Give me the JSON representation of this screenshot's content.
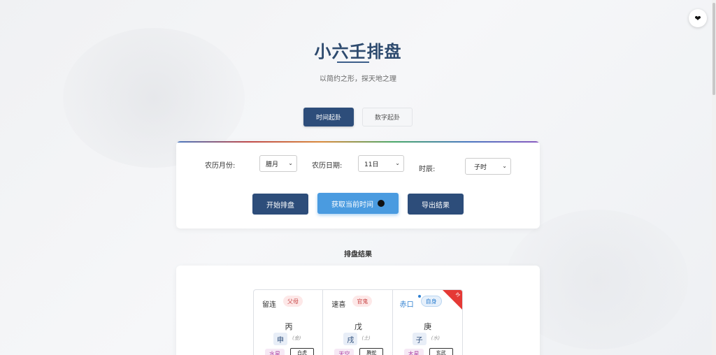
{
  "header": {
    "title": "小六壬排盘",
    "subtitle": "以简约之形，探天地之理",
    "favorite_icon": "heart-icon"
  },
  "tabs": [
    {
      "label": "时间起卦",
      "active": true
    },
    {
      "label": "数字起卦",
      "active": false
    }
  ],
  "form": {
    "month_label": "农历月份:",
    "month_value": "腊月",
    "date_label": "农历日期:",
    "date_value": "11日",
    "hour_label": "时辰:",
    "hour_value": "子时"
  },
  "buttons": {
    "start": "开始排盘",
    "now": "获取当前时间",
    "export": "导出结果"
  },
  "result": {
    "section_title": "排盘结果",
    "cells": [
      {
        "name": "留连",
        "relation": "父母",
        "gan": "丙",
        "zhi": "申",
        "wuxing": "(金)",
        "star": "水星",
        "tag": "白虎"
      },
      {
        "name": "速喜",
        "relation": "官鬼",
        "gan": "戊",
        "zhi": "戌",
        "wuxing": "(土)",
        "star": "天空",
        "tag": "腾蛇"
      },
      {
        "name": "赤口",
        "relation": "自身",
        "gan": "庚",
        "zhi": "子",
        "wuxing": "(水)",
        "star": "木星",
        "tag": "玄武",
        "corner": "时"
      }
    ]
  },
  "colors": {
    "primary": "#2d4d7a",
    "accent": "#4a9be0",
    "active_cell": "#2e7fd0",
    "corner_flag": "#e53935"
  }
}
